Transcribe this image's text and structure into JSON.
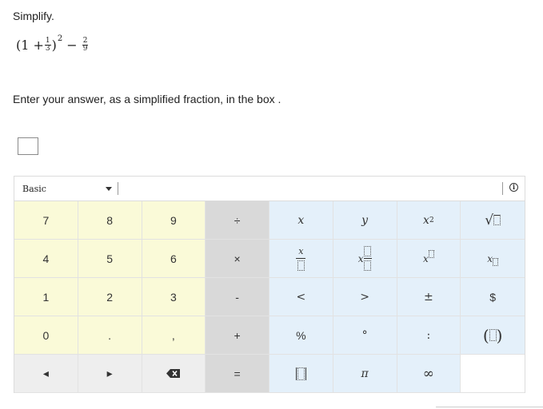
{
  "question": {
    "prompt": "Simplify.",
    "expression": {
      "open": "(1 + ",
      "frac1_num": "1",
      "frac1_den": "3",
      "close": ")",
      "exponent": "2",
      "minus": "−",
      "frac2_num": "2",
      "frac2_den": "9"
    },
    "instruction": "Enter your answer, as a simplified fraction, in the box ."
  },
  "answer": {
    "value": ""
  },
  "keypad": {
    "mode": "Basic",
    "info_symbol": "i",
    "keys": {
      "seven": "7",
      "eight": "8",
      "nine": "9",
      "divide": "÷",
      "x": "x",
      "y": "y",
      "x_squared_base": "x",
      "x_squared_exp": "2",
      "sqrt": "√",
      "four": "4",
      "five": "5",
      "six": "6",
      "times": "×",
      "frac_x": "x",
      "mixed_x": "x",
      "power_x": "x",
      "sub_x": "x",
      "one": "1",
      "two": "2",
      "three": "3",
      "minus": "-",
      "lt": "<",
      "gt": ">",
      "plusminus": "±",
      "dollar": "$",
      "zero": "0",
      "decimal": ".",
      "comma": ",",
      "plus": "+",
      "percent": "%",
      "degree": "°",
      "colon": ":",
      "paren_open": "(",
      "paren_close": ")",
      "left_arrow": "◂",
      "right_arrow": "▸",
      "equals": "=",
      "pi": "π",
      "infinity": "∞"
    }
  }
}
